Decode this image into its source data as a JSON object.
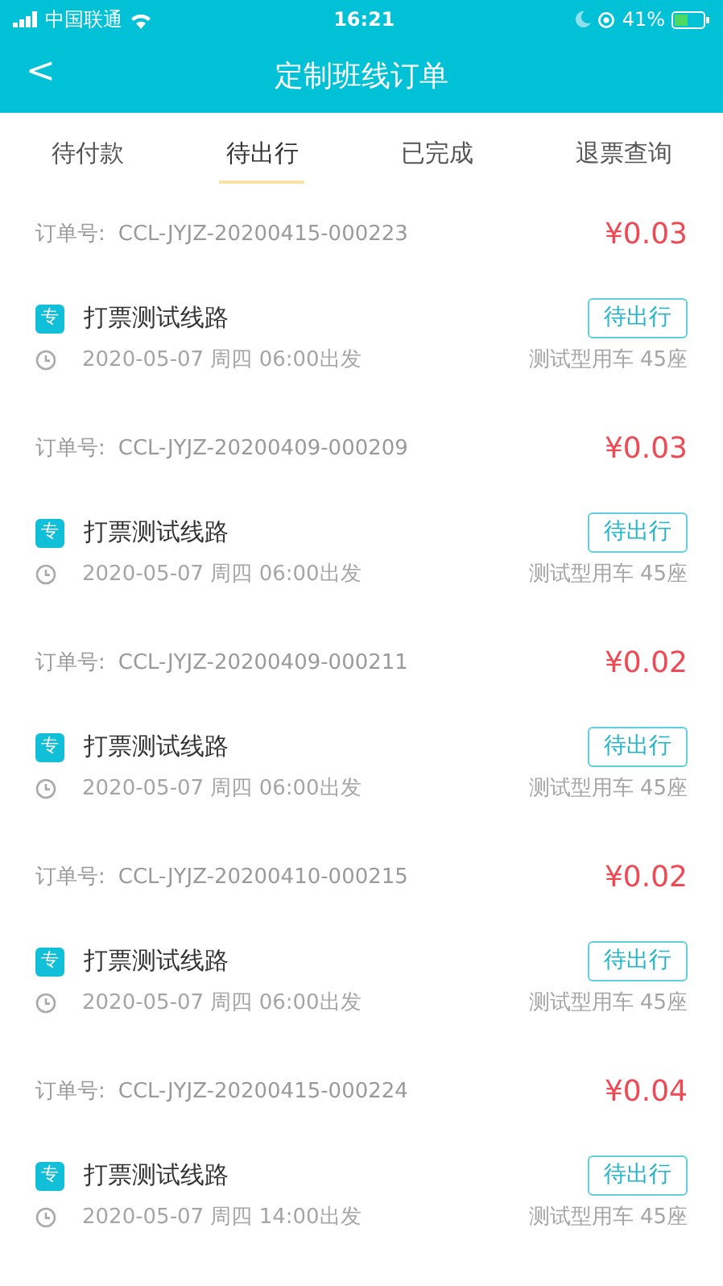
{
  "status_bar": {
    "carrier": "中国联通",
    "time": "16:21",
    "battery": "41%"
  },
  "header": {
    "back": "<",
    "title": "定制班线订单"
  },
  "tabs": [
    {
      "label": "待付款",
      "selected": false
    },
    {
      "label": "待出行",
      "selected": true
    },
    {
      "label": "已完成",
      "selected": false
    },
    {
      "label": "退票查询",
      "selected": false
    }
  ],
  "orders": [
    {
      "order_label": "订单号:",
      "order_no": "CCL-JYJZ-20200415-000223",
      "price": "¥0.03",
      "tag": "专",
      "route": "打票测试线路",
      "status": "待出行",
      "departure": "2020-05-07 周四 06:00出发",
      "vehicle": "测试型用车 45座"
    },
    {
      "order_label": "订单号:",
      "order_no": "CCL-JYJZ-20200409-000209",
      "price": "¥0.03",
      "tag": "专",
      "route": "打票测试线路",
      "status": "待出行",
      "departure": "2020-05-07 周四 06:00出发",
      "vehicle": "测试型用车 45座"
    },
    {
      "order_label": "订单号:",
      "order_no": "CCL-JYJZ-20200409-000211",
      "price": "¥0.02",
      "tag": "专",
      "route": "打票测试线路",
      "status": "待出行",
      "departure": "2020-05-07 周四 06:00出发",
      "vehicle": "测试型用车 45座"
    },
    {
      "order_label": "订单号:",
      "order_no": "CCL-JYJZ-20200410-000215",
      "price": "¥0.02",
      "tag": "专",
      "route": "打票测试线路",
      "status": "待出行",
      "departure": "2020-05-07 周四 06:00出发",
      "vehicle": "测试型用车 45座"
    },
    {
      "order_label": "订单号:",
      "order_no": "CCL-JYJZ-20200415-000224",
      "price": "¥0.04",
      "tag": "专",
      "route": "打票测试线路",
      "status": "待出行",
      "departure": "2020-05-07 周四 14:00出发",
      "vehicle": "测试型用车 45座"
    }
  ]
}
